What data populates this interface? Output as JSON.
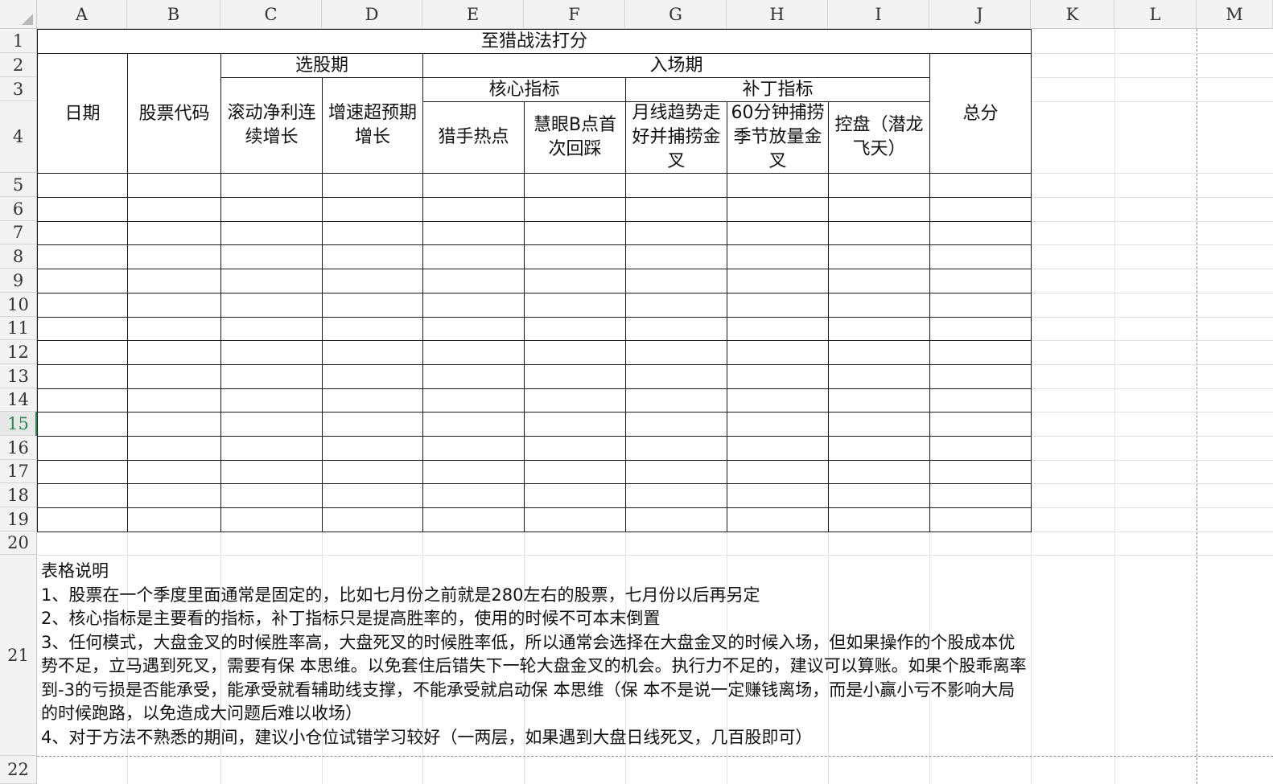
{
  "columns": [
    "A",
    "B",
    "C",
    "D",
    "E",
    "F",
    "G",
    "H",
    "I",
    "J",
    "K",
    "L",
    "M"
  ],
  "rows": [
    "1",
    "2",
    "3",
    "4",
    "5",
    "6",
    "7",
    "8",
    "9",
    "10",
    "11",
    "12",
    "13",
    "14",
    "15",
    "16",
    "17",
    "18",
    "19",
    "20",
    "21",
    "22"
  ],
  "active_row": "15",
  "table": {
    "title": "至猎战法打分",
    "date_header": "日期",
    "code_header": "股票代码",
    "selection_period": "选股期",
    "entry_period": "入场期",
    "total_header": "总分",
    "core_indicators": "核心指标",
    "supplement_indicators": "补丁指标",
    "selection_criteria": [
      "滚动净利连续增长",
      "增速超预期增长"
    ],
    "core_criteria": [
      "猎手热点",
      "慧眼B点首次回踩"
    ],
    "supplement_criteria": [
      "月线趋势走好并捕捞金叉",
      "60分钟捕捞季节放量金叉",
      "控盘（潜龙飞天）"
    ]
  },
  "notes": {
    "heading": "表格说明",
    "items": [
      "1、股票在一个季度里面通常是固定的，比如七月份之前就是280左右的股票，七月份以后再另定",
      "2、核心指标是主要看的指标，补丁指标只是提高胜率的，使用的时候不可本末倒置",
      "3、任何模式，大盘金叉的时候胜率高，大盘死叉的时候胜率低，所以通常会选择在大盘金叉的时候入场，但如果操作的个股成本优势不足，立马遇到死叉，需要有保 本思维。以免套住后错失下一轮大盘金叉的机会。执行力不足的，建议可以算账。如果个股乖离率到-3的亏损是否能承受，能承受就看辅助线支撑，不能承受就启动保 本思维（保 本不是说一定赚钱离场，而是小赢小亏不影响大局的时候跑路，以免造成大问题后难以收场）",
      "4、对于方法不熟悉的期间，建议小仓位试错学习较好（一两层，如果遇到大盘日线死叉，几百股即可）"
    ]
  }
}
